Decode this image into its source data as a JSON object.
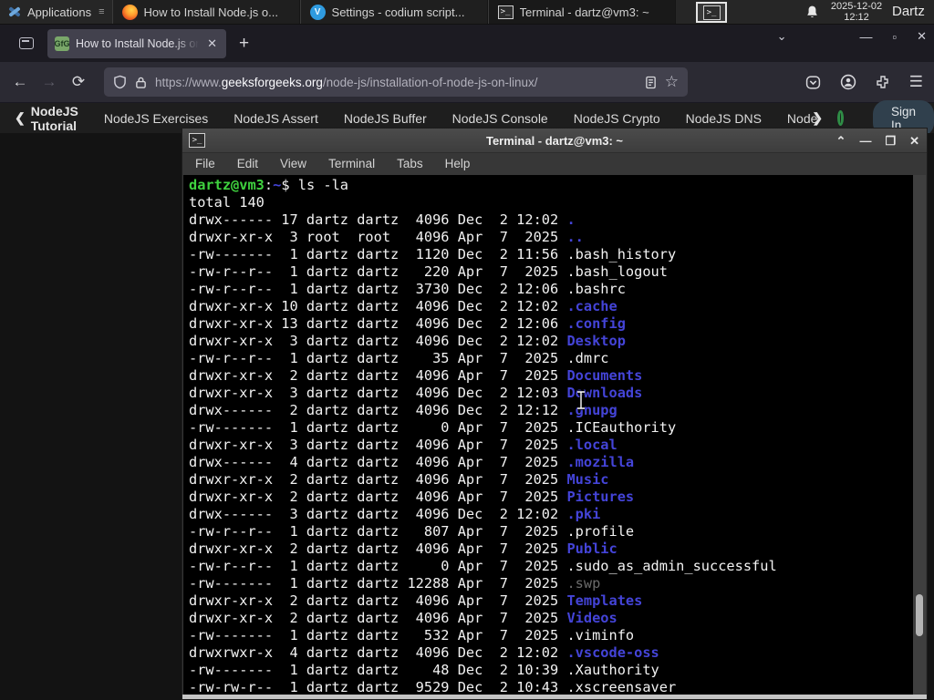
{
  "panel": {
    "applications_label": "Applications",
    "windows": [
      {
        "label": "How to Install Node.js o...",
        "icon": "firefox"
      },
      {
        "label": "Settings - codium script...",
        "icon": "vscodium"
      },
      {
        "label": "Terminal - dartz@vm3: ~",
        "icon": "terminal"
      }
    ],
    "clock_date": "2025-12-02",
    "clock_time": "12:12",
    "user": "Dartz"
  },
  "browser": {
    "tab_title": "How to Install Node.js on",
    "url_scheme": "https://www.",
    "url_domain": "geeksforgeeks.org",
    "url_path": "/node-js/installation-of-node-js-on-linux/",
    "new_tab": "+",
    "close": "✕",
    "minimize": "—",
    "back": "←",
    "forward": "→",
    "reload": "⟳",
    "star": "☆",
    "menu": "☰"
  },
  "subnav": {
    "back_label": "NodeJS Tutorial",
    "links": [
      "NodeJS Exercises",
      "NodeJS Assert",
      "NodeJS Buffer",
      "NodeJS Console",
      "NodeJS Crypto",
      "NodeJS DNS",
      "Node"
    ],
    "signin_label": "Sign In",
    "accent_green": "#2f8d46"
  },
  "terminal": {
    "title": "Terminal - dartz@vm3: ~",
    "menu": [
      "File",
      "Edit",
      "View",
      "Terminal",
      "Tabs",
      "Help"
    ],
    "controls": {
      "rollup": "⌃",
      "minimize": "▁",
      "maximize": "❒",
      "close": "✕"
    },
    "colors": {
      "prompt_green": "#3fd23f",
      "dir_blue": "#4444d8",
      "dim": "#6b6b6b",
      "fg": "#f2f2f2",
      "bg": "#000000"
    },
    "lines": [
      [
        [
          "dartz@vm3",
          "green"
        ],
        [
          ":",
          "fg"
        ],
        [
          "~",
          "blue"
        ],
        [
          "$ ls -la",
          "fg"
        ]
      ],
      [
        [
          "total 140",
          "fg"
        ]
      ],
      [
        [
          "drwx------ 17 dartz dartz  4096 Dec  2 12:02 ",
          "fg"
        ],
        [
          ".",
          "blue"
        ]
      ],
      [
        [
          "drwxr-xr-x  3 root  root   4096 Apr  7  2025 ",
          "fg"
        ],
        [
          "..",
          "blue"
        ]
      ],
      [
        [
          "-rw-------  1 dartz dartz  1120 Dec  2 11:56 ",
          "fg"
        ],
        [
          ".bash_history",
          "fg"
        ]
      ],
      [
        [
          "-rw-r--r--  1 dartz dartz   220 Apr  7  2025 ",
          "fg"
        ],
        [
          ".bash_logout",
          "fg"
        ]
      ],
      [
        [
          "-rw-r--r--  1 dartz dartz  3730 Dec  2 12:06 ",
          "fg"
        ],
        [
          ".bashrc",
          "fg"
        ]
      ],
      [
        [
          "drwxr-xr-x 10 dartz dartz  4096 Dec  2 12:02 ",
          "fg"
        ],
        [
          ".cache",
          "blue"
        ]
      ],
      [
        [
          "drwxr-xr-x 13 dartz dartz  4096 Dec  2 12:06 ",
          "fg"
        ],
        [
          ".config",
          "blue"
        ]
      ],
      [
        [
          "drwxr-xr-x  3 dartz dartz  4096 Dec  2 12:02 ",
          "fg"
        ],
        [
          "Desktop",
          "blue"
        ]
      ],
      [
        [
          "-rw-r--r--  1 dartz dartz    35 Apr  7  2025 ",
          "fg"
        ],
        [
          ".dmrc",
          "fg"
        ]
      ],
      [
        [
          "drwxr-xr-x  2 dartz dartz  4096 Apr  7  2025 ",
          "fg"
        ],
        [
          "Documents",
          "blue"
        ]
      ],
      [
        [
          "drwxr-xr-x  3 dartz dartz  4096 Dec  2 12:03 ",
          "fg"
        ],
        [
          "Downloads",
          "blue"
        ]
      ],
      [
        [
          "drwx------  2 dartz dartz  4096 Dec  2 12:12 ",
          "fg"
        ],
        [
          ".gnupg",
          "blue"
        ]
      ],
      [
        [
          "-rw-------  1 dartz dartz     0 Apr  7  2025 ",
          "fg"
        ],
        [
          ".ICEauthority",
          "fg"
        ]
      ],
      [
        [
          "drwxr-xr-x  3 dartz dartz  4096 Apr  7  2025 ",
          "fg"
        ],
        [
          ".local",
          "blue"
        ]
      ],
      [
        [
          "drwx------  4 dartz dartz  4096 Apr  7  2025 ",
          "fg"
        ],
        [
          ".mozilla",
          "blue"
        ]
      ],
      [
        [
          "drwxr-xr-x  2 dartz dartz  4096 Apr  7  2025 ",
          "fg"
        ],
        [
          "Music",
          "blue"
        ]
      ],
      [
        [
          "drwxr-xr-x  2 dartz dartz  4096 Apr  7  2025 ",
          "fg"
        ],
        [
          "Pictures",
          "blue"
        ]
      ],
      [
        [
          "drwx------  3 dartz dartz  4096 Dec  2 12:02 ",
          "fg"
        ],
        [
          ".pki",
          "blue"
        ]
      ],
      [
        [
          "-rw-r--r--  1 dartz dartz   807 Apr  7  2025 ",
          "fg"
        ],
        [
          ".profile",
          "fg"
        ]
      ],
      [
        [
          "drwxr-xr-x  2 dartz dartz  4096 Apr  7  2025 ",
          "fg"
        ],
        [
          "Public",
          "blue"
        ]
      ],
      [
        [
          "-rw-r--r--  1 dartz dartz     0 Apr  7  2025 ",
          "fg"
        ],
        [
          ".sudo_as_admin_successful",
          "fg"
        ]
      ],
      [
        [
          "-rw-------  1 dartz dartz 12288 Apr  7  2025 ",
          "fg"
        ],
        [
          ".swp",
          "dim"
        ]
      ],
      [
        [
          "drwxr-xr-x  2 dartz dartz  4096 Apr  7  2025 ",
          "fg"
        ],
        [
          "Templates",
          "blue"
        ]
      ],
      [
        [
          "drwxr-xr-x  2 dartz dartz  4096 Apr  7  2025 ",
          "fg"
        ],
        [
          "Videos",
          "blue"
        ]
      ],
      [
        [
          "-rw-------  1 dartz dartz   532 Apr  7  2025 ",
          "fg"
        ],
        [
          ".viminfo",
          "fg"
        ]
      ],
      [
        [
          "drwxrwxr-x  4 dartz dartz  4096 Dec  2 12:02 ",
          "fg"
        ],
        [
          ".vscode-oss",
          "blue"
        ]
      ],
      [
        [
          "-rw-------  1 dartz dartz    48 Dec  2 10:39 ",
          "fg"
        ],
        [
          ".Xauthority",
          "fg"
        ]
      ],
      [
        [
          "-rw-rw-r--  1 dartz dartz  9529 Dec  2 10:43 ",
          "fg"
        ],
        [
          ".xscreensaver",
          "fg"
        ]
      ]
    ]
  }
}
